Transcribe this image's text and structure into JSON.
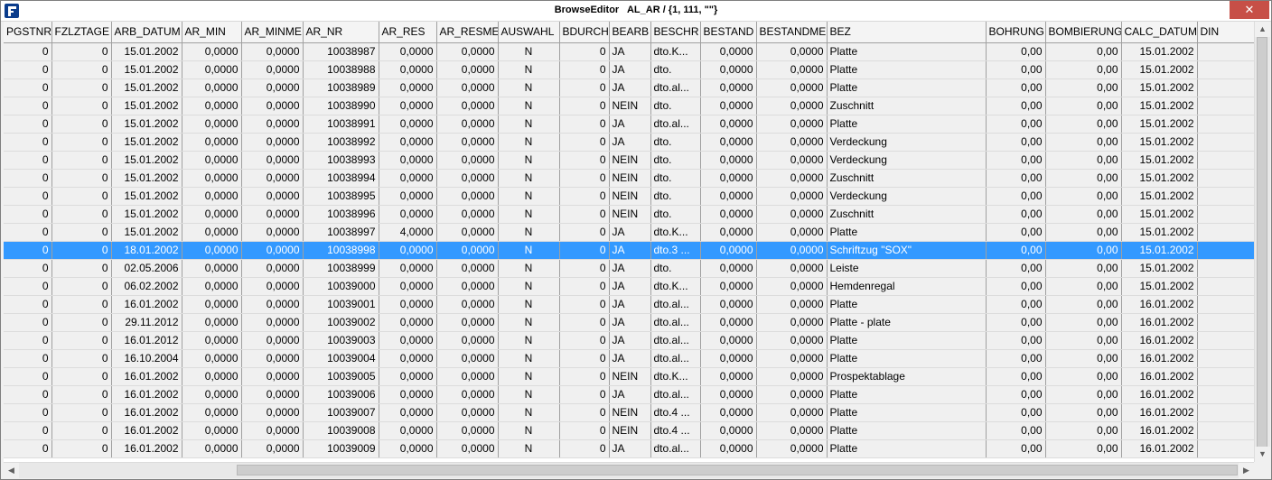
{
  "window": {
    "title": "BrowseEditor   AL_AR / {1, 111, \"\"}",
    "close_glyph": "✕",
    "accent_close": "#c74f47",
    "selection_color": "#3399ff"
  },
  "grid": {
    "columns": [
      "PGSTNR",
      "FZLZTAGE",
      "ARB_DATUM",
      "AR_MIN",
      "AR_MINME",
      "AR_NR",
      "AR_RES",
      "AR_RESME",
      "AUSWAHL",
      "BDURCH",
      "BEARB",
      "BESCHR",
      "BESTAND",
      "BESTANDME",
      "BEZ",
      "BOHRUNG",
      "BOMBIERUNG",
      "CALC_DATUM",
      "DIN"
    ],
    "selected_row": 11,
    "rows": [
      [
        "0",
        "0",
        "15.01.2002",
        "0,0000",
        "0,0000",
        "10038987",
        "0,0000",
        "0,0000",
        "N",
        "0",
        "JA",
        "dto.K...",
        "0,0000",
        "0,0000",
        "Platte",
        "0,00",
        "0,00",
        "15.01.2002",
        ""
      ],
      [
        "0",
        "0",
        "15.01.2002",
        "0,0000",
        "0,0000",
        "10038988",
        "0,0000",
        "0,0000",
        "N",
        "0",
        "JA",
        "dto.",
        "0,0000",
        "0,0000",
        "Platte",
        "0,00",
        "0,00",
        "15.01.2002",
        ""
      ],
      [
        "0",
        "0",
        "15.01.2002",
        "0,0000",
        "0,0000",
        "10038989",
        "0,0000",
        "0,0000",
        "N",
        "0",
        "JA",
        "dto.al...",
        "0,0000",
        "0,0000",
        "Platte",
        "0,00",
        "0,00",
        "15.01.2002",
        ""
      ],
      [
        "0",
        "0",
        "15.01.2002",
        "0,0000",
        "0,0000",
        "10038990",
        "0,0000",
        "0,0000",
        "N",
        "0",
        "NEIN",
        "dto.",
        "0,0000",
        "0,0000",
        "Zuschnitt",
        "0,00",
        "0,00",
        "15.01.2002",
        ""
      ],
      [
        "0",
        "0",
        "15.01.2002",
        "0,0000",
        "0,0000",
        "10038991",
        "0,0000",
        "0,0000",
        "N",
        "0",
        "JA",
        "dto.al...",
        "0,0000",
        "0,0000",
        "Platte",
        "0,00",
        "0,00",
        "15.01.2002",
        ""
      ],
      [
        "0",
        "0",
        "15.01.2002",
        "0,0000",
        "0,0000",
        "10038992",
        "0,0000",
        "0,0000",
        "N",
        "0",
        "JA",
        "dto.",
        "0,0000",
        "0,0000",
        "Verdeckung",
        "0,00",
        "0,00",
        "15.01.2002",
        ""
      ],
      [
        "0",
        "0",
        "15.01.2002",
        "0,0000",
        "0,0000",
        "10038993",
        "0,0000",
        "0,0000",
        "N",
        "0",
        "NEIN",
        "dto.",
        "0,0000",
        "0,0000",
        "Verdeckung",
        "0,00",
        "0,00",
        "15.01.2002",
        ""
      ],
      [
        "0",
        "0",
        "15.01.2002",
        "0,0000",
        "0,0000",
        "10038994",
        "0,0000",
        "0,0000",
        "N",
        "0",
        "NEIN",
        "dto.",
        "0,0000",
        "0,0000",
        "Zuschnitt",
        "0,00",
        "0,00",
        "15.01.2002",
        ""
      ],
      [
        "0",
        "0",
        "15.01.2002",
        "0,0000",
        "0,0000",
        "10038995",
        "0,0000",
        "0,0000",
        "N",
        "0",
        "NEIN",
        "dto.",
        "0,0000",
        "0,0000",
        "Verdeckung",
        "0,00",
        "0,00",
        "15.01.2002",
        ""
      ],
      [
        "0",
        "0",
        "15.01.2002",
        "0,0000",
        "0,0000",
        "10038996",
        "0,0000",
        "0,0000",
        "N",
        "0",
        "NEIN",
        "dto.",
        "0,0000",
        "0,0000",
        "Zuschnitt",
        "0,00",
        "0,00",
        "15.01.2002",
        ""
      ],
      [
        "0",
        "0",
        "15.01.2002",
        "0,0000",
        "0,0000",
        "10038997",
        "4,0000",
        "0,0000",
        "N",
        "0",
        "JA",
        "dto.K...",
        "0,0000",
        "0,0000",
        "Platte",
        "0,00",
        "0,00",
        "15.01.2002",
        ""
      ],
      [
        "0",
        "0",
        "18.01.2002",
        "0,0000",
        "0,0000",
        "10038998",
        "0,0000",
        "0,0000",
        "N",
        "0",
        "JA",
        "dto.3 ...",
        "0,0000",
        "0,0000",
        "Schriftzug \"SOX\"",
        "0,00",
        "0,00",
        "15.01.2002",
        ""
      ],
      [
        "0",
        "0",
        "02.05.2006",
        "0,0000",
        "0,0000",
        "10038999",
        "0,0000",
        "0,0000",
        "N",
        "0",
        "JA",
        "dto.",
        "0,0000",
        "0,0000",
        "Leiste",
        "0,00",
        "0,00",
        "15.01.2002",
        ""
      ],
      [
        "0",
        "0",
        "06.02.2002",
        "0,0000",
        "0,0000",
        "10039000",
        "0,0000",
        "0,0000",
        "N",
        "0",
        "JA",
        "dto.K...",
        "0,0000",
        "0,0000",
        "Hemdenregal",
        "0,00",
        "0,00",
        "15.01.2002",
        ""
      ],
      [
        "0",
        "0",
        "16.01.2002",
        "0,0000",
        "0,0000",
        "10039001",
        "0,0000",
        "0,0000",
        "N",
        "0",
        "JA",
        "dto.al...",
        "0,0000",
        "0,0000",
        "Platte",
        "0,00",
        "0,00",
        "16.01.2002",
        ""
      ],
      [
        "0",
        "0",
        "29.11.2012",
        "0,0000",
        "0,0000",
        "10039002",
        "0,0000",
        "0,0000",
        "N",
        "0",
        "JA",
        "dto.al...",
        "0,0000",
        "0,0000",
        "Platte - plate",
        "0,00",
        "0,00",
        "16.01.2002",
        ""
      ],
      [
        "0",
        "0",
        "16.01.2012",
        "0,0000",
        "0,0000",
        "10039003",
        "0,0000",
        "0,0000",
        "N",
        "0",
        "JA",
        "dto.al...",
        "0,0000",
        "0,0000",
        "Platte",
        "0,00",
        "0,00",
        "16.01.2002",
        ""
      ],
      [
        "0",
        "0",
        "16.10.2004",
        "0,0000",
        "0,0000",
        "10039004",
        "0,0000",
        "0,0000",
        "N",
        "0",
        "JA",
        "dto.al...",
        "0,0000",
        "0,0000",
        "Platte",
        "0,00",
        "0,00",
        "16.01.2002",
        ""
      ],
      [
        "0",
        "0",
        "16.01.2002",
        "0,0000",
        "0,0000",
        "10039005",
        "0,0000",
        "0,0000",
        "N",
        "0",
        "NEIN",
        "dto.K...",
        "0,0000",
        "0,0000",
        "Prospektablage",
        "0,00",
        "0,00",
        "16.01.2002",
        ""
      ],
      [
        "0",
        "0",
        "16.01.2002",
        "0,0000",
        "0,0000",
        "10039006",
        "0,0000",
        "0,0000",
        "N",
        "0",
        "JA",
        "dto.al...",
        "0,0000",
        "0,0000",
        "Platte",
        "0,00",
        "0,00",
        "16.01.2002",
        ""
      ],
      [
        "0",
        "0",
        "16.01.2002",
        "0,0000",
        "0,0000",
        "10039007",
        "0,0000",
        "0,0000",
        "N",
        "0",
        "NEIN",
        "dto.4 ...",
        "0,0000",
        "0,0000",
        "Platte",
        "0,00",
        "0,00",
        "16.01.2002",
        ""
      ],
      [
        "0",
        "0",
        "16.01.2002",
        "0,0000",
        "0,0000",
        "10039008",
        "0,0000",
        "0,0000",
        "N",
        "0",
        "NEIN",
        "dto.4 ...",
        "0,0000",
        "0,0000",
        "Platte",
        "0,00",
        "0,00",
        "16.01.2002",
        ""
      ],
      [
        "0",
        "0",
        "16.01.2002",
        "0,0000",
        "0,0000",
        "10039009",
        "0,0000",
        "0,0000",
        "N",
        "0",
        "JA",
        "dto.al...",
        "0,0000",
        "0,0000",
        "Platte",
        "0,00",
        "0,00",
        "16.01.2002",
        ""
      ]
    ]
  },
  "scrollbars": {
    "up_glyph": "▲",
    "down_glyph": "▼",
    "left_glyph": "◀",
    "right_glyph": "▶"
  }
}
